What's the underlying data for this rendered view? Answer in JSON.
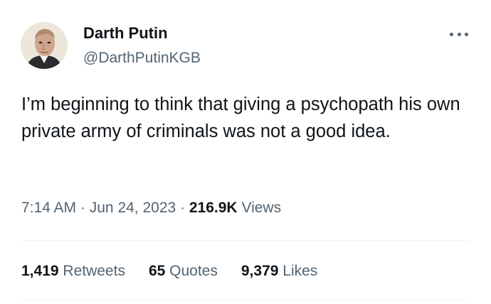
{
  "author": {
    "display_name": "Darth Putin",
    "handle": "@DarthPutinKGB",
    "avatar_icon": "profile-photo-avatar"
  },
  "more_icon": "ellipsis-icon",
  "tweet": {
    "text": "I’m beginning to think that giving a psychopath his own private army of criminals was not a good idea."
  },
  "meta": {
    "time": "7:14 AM",
    "separator": "·",
    "date": "Jun 24, 2023",
    "views_count": "216.9K",
    "views_label": "Views"
  },
  "stats": {
    "retweets_count": "1,419",
    "retweets_label": "Retweets",
    "quotes_count": "65",
    "quotes_label": "Quotes",
    "likes_count": "9,379",
    "likes_label": "Likes"
  },
  "colors": {
    "primary_text": "#0f1419",
    "secondary_text": "#536471",
    "divider": "#eff3f4"
  }
}
